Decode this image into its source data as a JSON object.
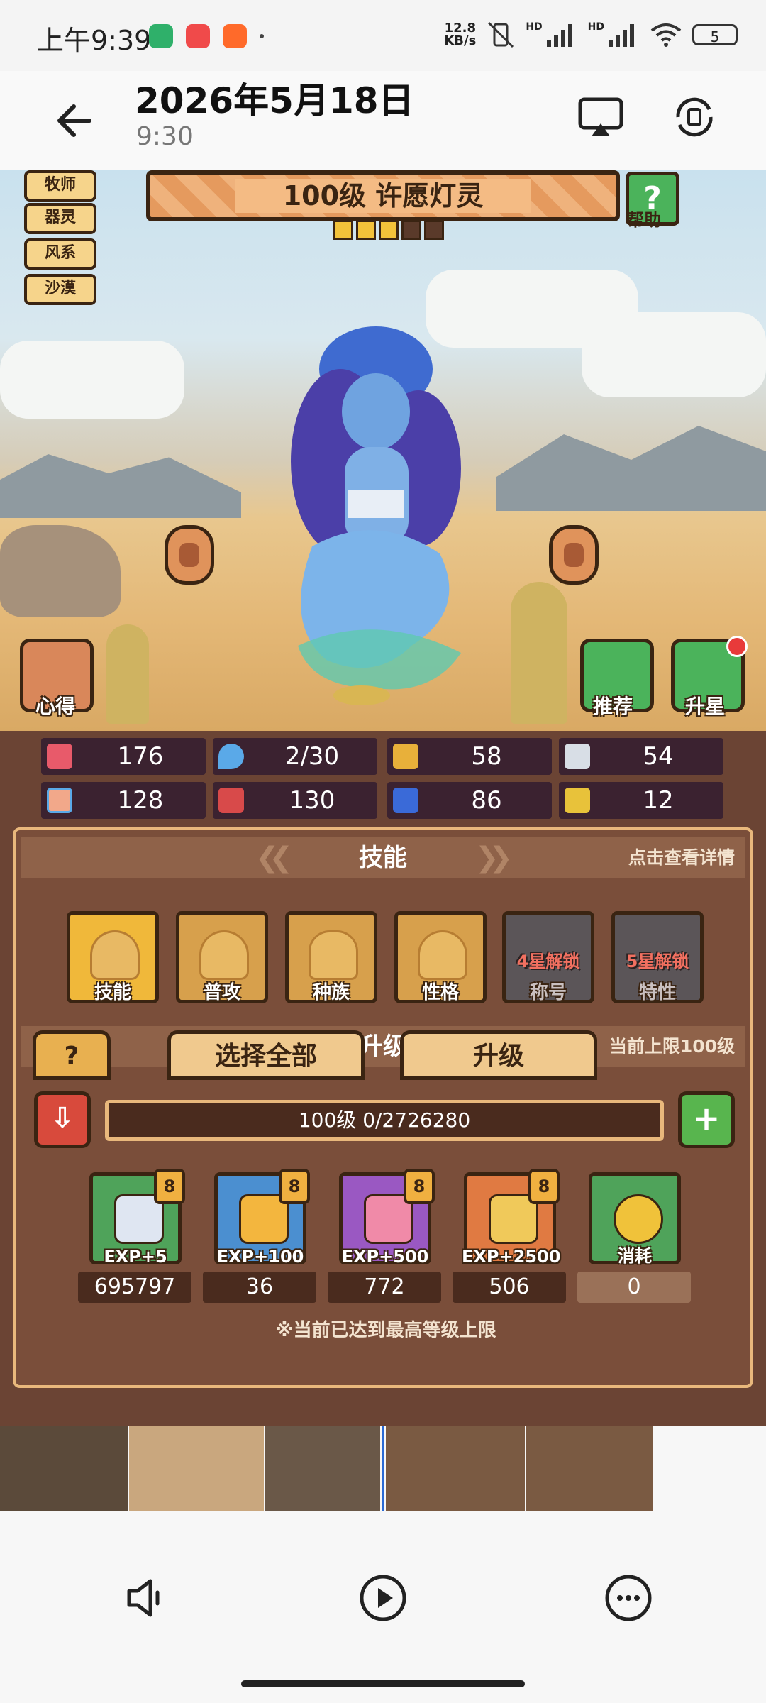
{
  "status_bar": {
    "time": "上午9:39",
    "net_speed_value": "12.8",
    "net_speed_unit": "KB/s",
    "hd1": "HD",
    "hd2": "HD",
    "battery": "5"
  },
  "header": {
    "date": "2026年5月18日",
    "time": "9:30",
    "back_icon": "arrow-left-icon",
    "cast_icon": "airplay-icon",
    "rotate_icon": "rotate-icon"
  },
  "game": {
    "tags": [
      "牧师",
      "器灵",
      "风系",
      "沙漠"
    ],
    "title": "100级 许愿灯灵",
    "stars_filled": 3,
    "stars_total": 5,
    "help_label": "帮助",
    "left_button": "心得",
    "recommend_button": "推荐",
    "upstar_button": "升星",
    "stats": [
      {
        "icon": "heart-icon",
        "value": "176"
      },
      {
        "icon": "water-drop-icon",
        "value": "2/30"
      },
      {
        "icon": "shield-icon",
        "value": "58"
      },
      {
        "icon": "wing-icon",
        "value": "54"
      },
      {
        "icon": "fist-icon",
        "value": "128"
      },
      {
        "icon": "book-icon",
        "value": "130"
      },
      {
        "icon": "boot-icon",
        "value": "86"
      },
      {
        "icon": "horseshoe-icon",
        "value": "12"
      }
    ],
    "skills_section": {
      "title": "技能",
      "right_hint": "点击查看详情",
      "items": [
        {
          "label": "技能",
          "lock": ""
        },
        {
          "label": "普攻",
          "lock": ""
        },
        {
          "label": "种族",
          "lock": ""
        },
        {
          "label": "性格",
          "lock": ""
        },
        {
          "label": "称号",
          "lock": "4星解锁"
        },
        {
          "label": "特性",
          "lock": "5星解锁"
        }
      ]
    },
    "upgrade_section": {
      "title": "升级",
      "right_hint": "当前上限100级",
      "exp_text": "100级 0/2726280",
      "items": [
        {
          "label": "EXP+5",
          "count": "695797",
          "badge": "8",
          "color": "#4fa35a"
        },
        {
          "label": "EXP+100",
          "count": "36",
          "badge": "8",
          "color": "#4b8fd0"
        },
        {
          "label": "EXP+500",
          "count": "772",
          "badge": "8",
          "color": "#9a58c2"
        },
        {
          "label": "EXP+2500",
          "count": "506",
          "badge": "8",
          "color": "#e07a42"
        },
        {
          "label": "消耗",
          "count": "0",
          "badge": "",
          "color": "#4fa35a"
        }
      ],
      "note": "※当前已达到最高等级上限"
    },
    "bottom_buttons": [
      "选择全部",
      "升级"
    ]
  },
  "toolbar": {
    "volume_icon": "speaker-icon",
    "play_icon": "play-icon",
    "more_icon": "more-icon"
  },
  "colors": {
    "panel": "#6b4434",
    "accent_orange": "#e9a268",
    "green_button": "#4bb35b",
    "red_button": "#d84a3c"
  }
}
